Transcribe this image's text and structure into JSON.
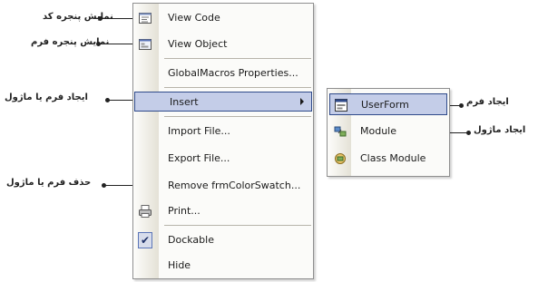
{
  "menu": {
    "items": [
      {
        "label": "View Code",
        "icon": "code-window-icon"
      },
      {
        "label": "View Object",
        "icon": "form-window-icon"
      },
      {
        "label": "GlobalMacros Properties...",
        "icon": ""
      },
      {
        "label": "Insert",
        "icon": "",
        "has_submenu": true,
        "highlighted": true
      },
      {
        "label": "Import File...",
        "icon": ""
      },
      {
        "label": "Export File...",
        "icon": ""
      },
      {
        "label": "Remove frmColorSwatch...",
        "icon": ""
      },
      {
        "label": "Print...",
        "icon": "printer-icon"
      },
      {
        "label": "Dockable",
        "icon": "checkmark-icon",
        "checked": true
      },
      {
        "label": "Hide",
        "icon": ""
      }
    ]
  },
  "submenu": {
    "items": [
      {
        "label": "UserForm",
        "icon": "userform-icon",
        "highlighted": true
      },
      {
        "label": "Module",
        "icon": "module-icon"
      },
      {
        "label": "Class Module",
        "icon": "class-module-icon"
      }
    ]
  },
  "annotations": {
    "view_code": "نمایش پنجره کد",
    "view_object": "نمایش پنجره فرم",
    "insert": "ایجاد فرم یا ماژول",
    "remove": "حذف فرم یا ماژول",
    "userform": "ایجاد فرم",
    "module": "ایجاد ماژول"
  },
  "colors": {
    "highlight_bg": "#c4cde8",
    "highlight_border": "#2f4a8a",
    "menu_bg": "#fbfbf9"
  }
}
